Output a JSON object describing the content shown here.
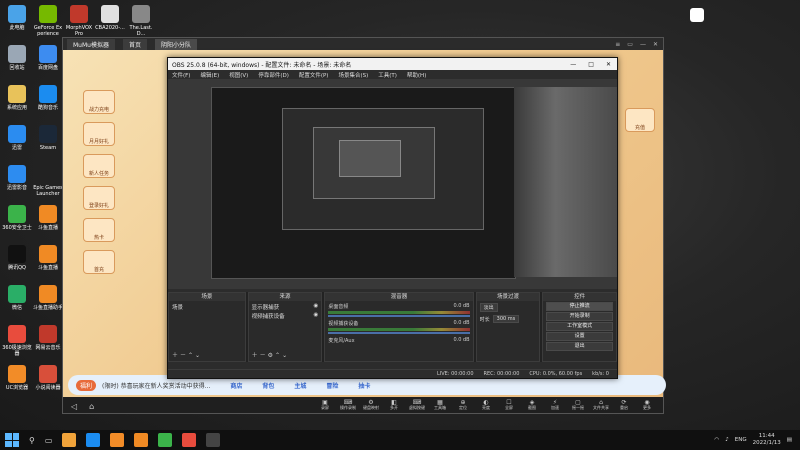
{
  "desktop": {
    "icons": [
      {
        "label": "此电脑",
        "color": "#4aa3e8"
      },
      {
        "label": "GeForce Experience",
        "color": "#76b900"
      },
      {
        "label": "MorphVOX Pro",
        "color": "#c0392b"
      },
      {
        "label": "CBA2020-...",
        "color": "#e0e0e0"
      },
      {
        "label": "The.Last.D...",
        "color": "#888888"
      },
      {
        "label": "回收站",
        "color": "#9aa7b5"
      },
      {
        "label": "百度网盘",
        "color": "#3d8cf0"
      },
      {
        "label": "系统应用",
        "color": "#e8c25a"
      },
      {
        "label": "酷狗音乐",
        "color": "#1b8cf0"
      },
      {
        "label": "迅雷",
        "color": "#2b8cf0"
      },
      {
        "label": "Steam",
        "color": "#1b2838"
      },
      {
        "label": "迅雷影音",
        "color": "#2d8cf0"
      },
      {
        "label": "Epic Games Launcher",
        "color": "#222222"
      },
      {
        "label": "360安全卫士",
        "color": "#3bb34a"
      },
      {
        "label": "斗鱼直播",
        "color": "#f08a24"
      },
      {
        "label": "腾讯QQ",
        "color": "#111111"
      },
      {
        "label": "斗鱼直播",
        "color": "#f08a24"
      },
      {
        "label": "微信",
        "color": "#2aae67"
      },
      {
        "label": "斗鱼直播助手",
        "color": "#f08a24"
      },
      {
        "label": "360极速浏览器",
        "color": "#e84c3d"
      },
      {
        "label": "网易云音乐",
        "color": "#c0392b"
      },
      {
        "label": "UC浏览器",
        "color": "#f28c28"
      },
      {
        "label": "小说阅读器",
        "color": "#d84f3a"
      }
    ]
  },
  "mumu": {
    "tabs": [
      "MuMu模拟器",
      "首页",
      "阴阳小分队"
    ],
    "controls": [
      "≡",
      "▭",
      "—",
      "✕"
    ],
    "game": {
      "left_buttons": [
        "战力充电",
        "月月好礼",
        "新人任务",
        "登录好礼",
        "热卡",
        "首充"
      ],
      "right_buttons": [
        "充值"
      ],
      "tag": "福利",
      "ticker": "(限时) 恭喜玩家在新人奖赏活动中获得...",
      "zones": [
        "商店",
        "背包",
        "主城",
        "冒险",
        "抽卡"
      ]
    },
    "nav": [
      "◁",
      "⌂"
    ],
    "toolbar": [
      {
        "glyph": "▣",
        "label": "录屏"
      },
      {
        "glyph": "⌨",
        "label": "操作录制"
      },
      {
        "glyph": "⚙",
        "label": "键盘映射"
      },
      {
        "glyph": "◧",
        "label": "多开"
      },
      {
        "glyph": "⌨",
        "label": "虚拟按键"
      },
      {
        "glyph": "▦",
        "label": "工具箱"
      },
      {
        "glyph": "⊕",
        "label": "定位"
      },
      {
        "glyph": "◐",
        "label": "亮度"
      },
      {
        "glyph": "☐",
        "label": "全屏"
      },
      {
        "glyph": "◈",
        "label": "截图"
      },
      {
        "glyph": "⚡",
        "label": "加速"
      },
      {
        "glyph": "▢",
        "label": "摇一摇"
      },
      {
        "glyph": "⌂",
        "label": "文件共享"
      },
      {
        "glyph": "⟳",
        "label": "重启"
      },
      {
        "glyph": "◉",
        "label": "更多"
      }
    ]
  },
  "obs": {
    "title": "OBS 25.0.8 (64-bit, windows) - 配置文件: 未命名 - 场景: 未命名",
    "controls": [
      "—",
      "□",
      "✕"
    ],
    "menu": [
      "文件(F)",
      "编辑(E)",
      "视图(V)",
      "停靠部件(D)",
      "配置文件(P)",
      "场景集合(S)",
      "工具(T)",
      "帮助(H)"
    ],
    "docks": {
      "scenes": {
        "title": "场景",
        "items": [
          "场景"
        ]
      },
      "sources": {
        "title": "来源",
        "items": [
          "显示器捕获",
          "视频捕获设备"
        ]
      },
      "mixer": {
        "title": "混音器",
        "tracks": [
          {
            "name": "桌面音频",
            "db": "0.0 dB"
          },
          {
            "name": "视频捕获设备",
            "db": "0.0 dB"
          },
          {
            "name": "麦克风/Aux",
            "db": "0.0 dB"
          }
        ]
      },
      "transitions": {
        "title": "场景过渡",
        "type": "淡出",
        "duration_label": "时长",
        "duration": "300 ms"
      },
      "controls": {
        "title": "控件",
        "buttons": [
          "停止推流",
          "开始录制",
          "工作室模式",
          "设置",
          "退出"
        ]
      }
    },
    "status": {
      "live": "LIVE: 00:00:00",
      "rec": "REC: 00:00:00",
      "cpu": "CPU: 0.0%, 60.00 fps",
      "kbps": "kb/s: 0"
    }
  },
  "taskbar": {
    "lang": "ENG",
    "time": "11:44",
    "date": "2022/1/13",
    "apps": [
      "#f0a33a",
      "#1b8cf0",
      "#f28c28",
      "#f08a24",
      "#3bb34a",
      "#e84c3d",
      "#444444"
    ]
  }
}
